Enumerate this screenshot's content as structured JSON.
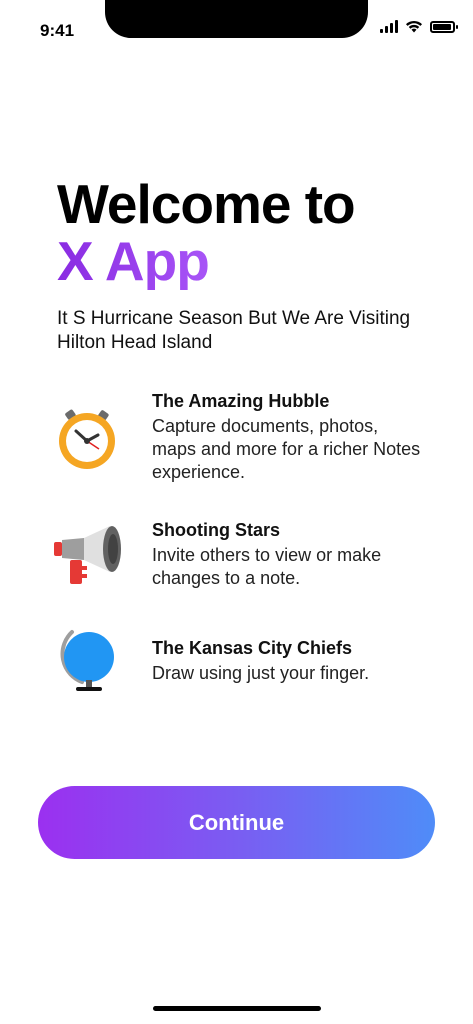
{
  "status_bar": {
    "time": "9:41"
  },
  "headline": {
    "line1": "Welcome to",
    "line2": "X App"
  },
  "subtitle": "It S Hurricane Season But We Are Visiting Hilton Head Island",
  "features": [
    {
      "icon": "clock-icon",
      "title": "The Amazing Hubble",
      "description": "Capture documents, photos, maps and more for a richer Notes experience."
    },
    {
      "icon": "megaphone-icon",
      "title": "Shooting Stars",
      "description": "Invite others to view or make changes to a note."
    },
    {
      "icon": "globe-icon",
      "title": "The Kansas City Chiefs",
      "description": "Draw using just your finger."
    }
  ],
  "continue_button": {
    "label": "Continue"
  },
  "colors": {
    "accent_start": "#9b30f0",
    "accent_end": "#4f8cf8",
    "headline_accent": "#8a2be2"
  }
}
